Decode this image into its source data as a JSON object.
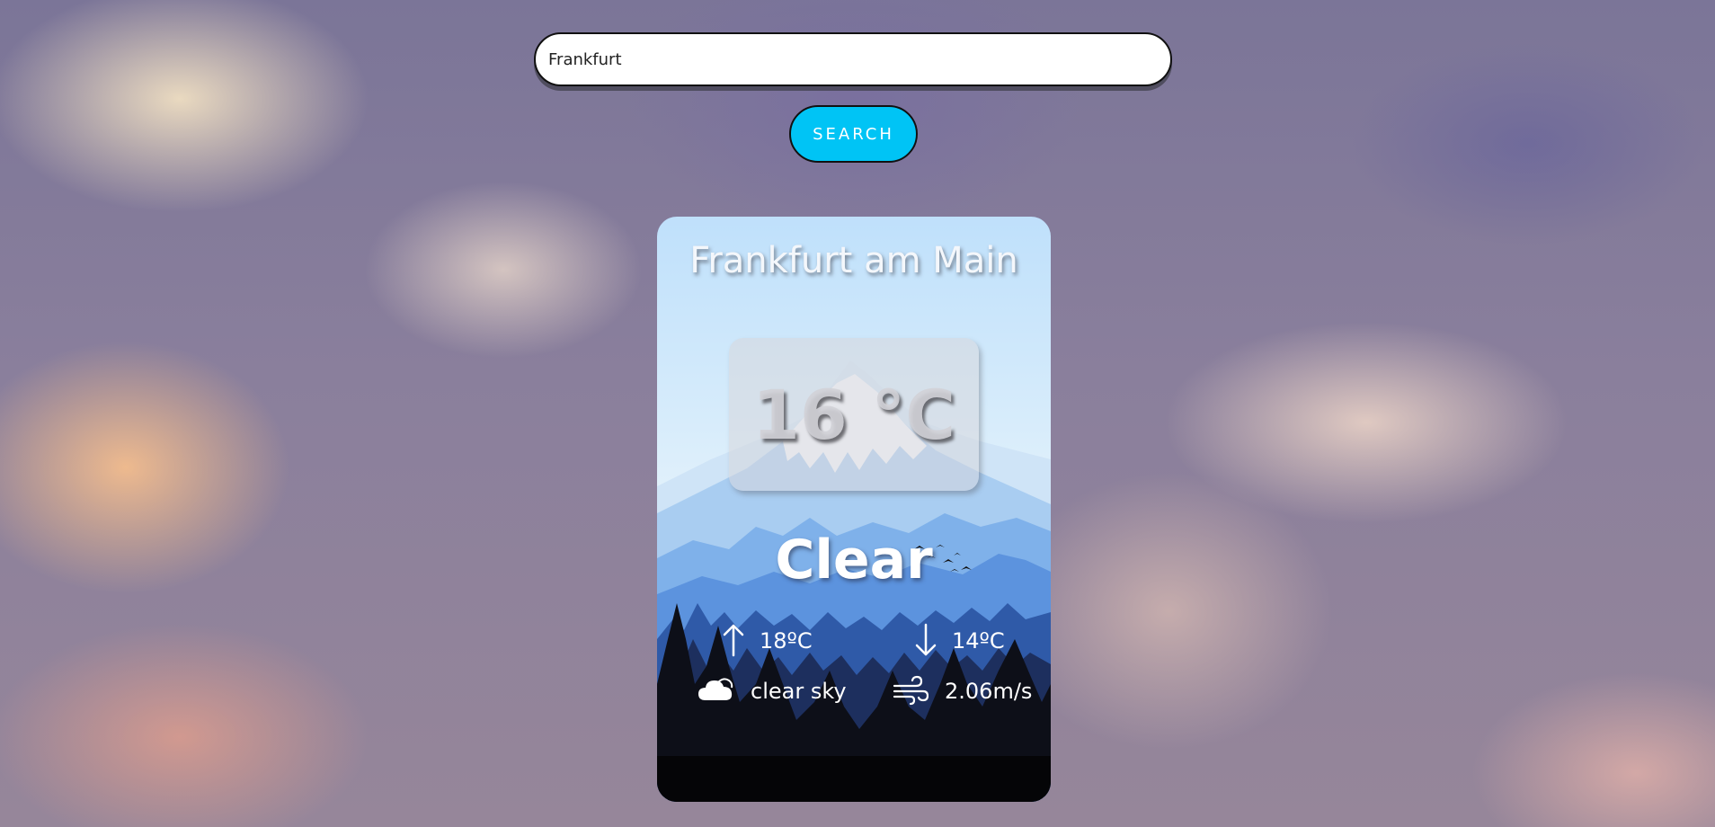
{
  "search": {
    "value": "Frankfurt",
    "button_label": "SEARCH"
  },
  "card": {
    "city": "Frankfurt am Main",
    "temperature": "16 °C",
    "condition": "Clear",
    "max_temp": "18ºC",
    "min_temp": "14ºC",
    "description": "clear sky",
    "wind_speed": "2.06m/s"
  },
  "icons": {
    "max": "arrow-up-icon",
    "min": "arrow-down-icon",
    "description": "cloud-icon",
    "wind": "wind-icon"
  },
  "colors": {
    "accent": "#00c4f5",
    "card_text": "#ffffff"
  }
}
